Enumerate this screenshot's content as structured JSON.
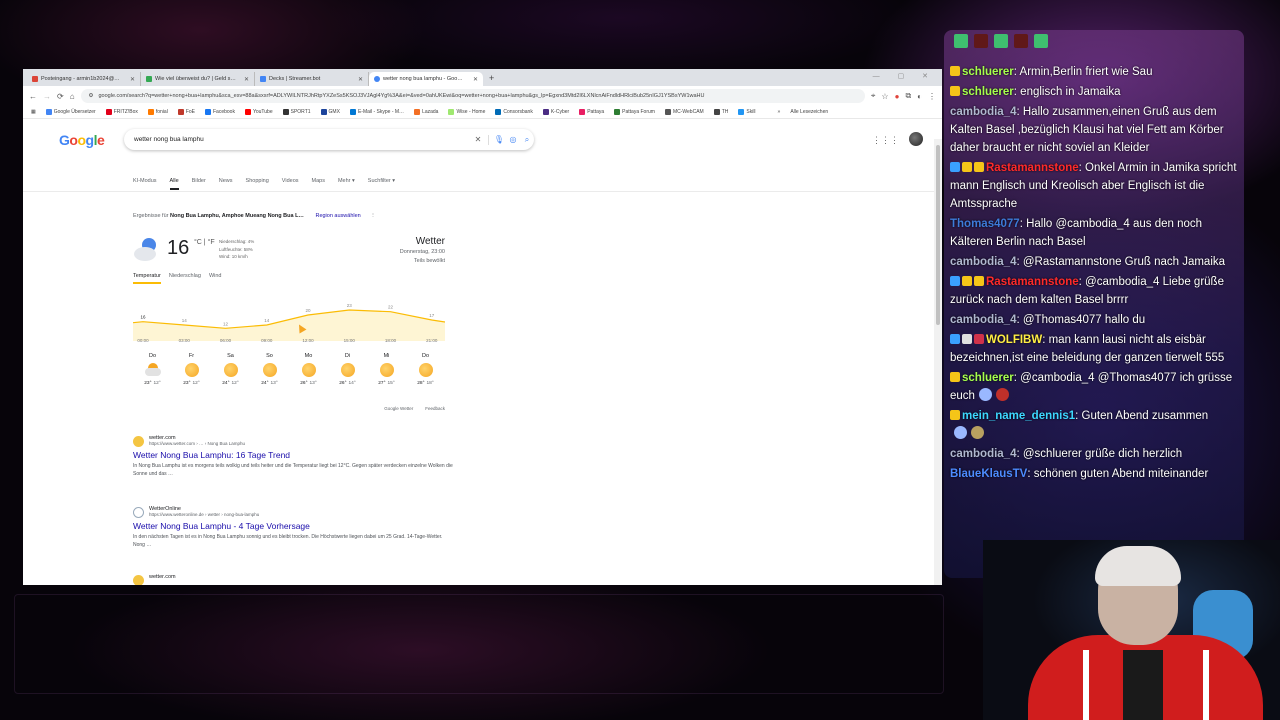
{
  "browser": {
    "tabs": [
      {
        "label": "Posteingang - armin1b2024@…",
        "color": "#db4437"
      },
      {
        "label": "Wie viel überweist du? | Geld s…",
        "color": "#34a853"
      },
      {
        "label": "Decks | Streamer.bot",
        "color": "#4285f4"
      },
      {
        "label": "wetter nong bua lamphu - Goo…",
        "color": "#4285f4"
      }
    ],
    "new_tab": "+",
    "url": "google.com/search?q=wetter+nong+bua+lamphu&sca_esv=88a&sxsrf=ADLYWILNTRJhRtpYXZeSs5KSOJ3VJAgl4Yg%3A&ei=&ved=0ahUKEwi&oq=wetter+nong+bua+lamphu&gs_lp=Egxnd3Mtd2l6LXNlcnAiFndldHRlciBub25nIGJ1YSBsYW1waHU",
    "bookmarks": [
      {
        "label": "Google Übersetzer",
        "color": "#4285f4"
      },
      {
        "label": "FRITZ!Box",
        "color": "#e2001a"
      },
      {
        "label": "fonial",
        "color": "#ff7a00"
      },
      {
        "label": "FoE",
        "color": "#c0392b"
      },
      {
        "label": "Facebook",
        "color": "#1877f2"
      },
      {
        "label": "YouTube",
        "color": "#ff0000"
      },
      {
        "label": "SPORT1",
        "color": "#333333"
      },
      {
        "label": "GMX",
        "color": "#1c449b"
      },
      {
        "label": "E-Mail - Skype - M…",
        "color": "#0078d4"
      },
      {
        "label": "Lazada",
        "color": "#f36f24"
      },
      {
        "label": "Wise - Home",
        "color": "#9fe870"
      },
      {
        "label": "Consorsbank",
        "color": "#006bb6"
      },
      {
        "label": "K-Cyber",
        "color": "#4a2c83"
      },
      {
        "label": "Pattaya",
        "color": "#e91e63"
      },
      {
        "label": "Pattaya Forum",
        "color": "#2e7d32"
      },
      {
        "label": "MC-WebCAM",
        "color": "#555555"
      },
      {
        "label": "TH",
        "color": "#444444"
      },
      {
        "label": "Skill",
        "color": "#2196f3"
      }
    ],
    "all_bookmarks": "Alle Lesezeichen"
  },
  "google": {
    "logo": [
      "G",
      "o",
      "o",
      "g",
      "l",
      "e"
    ],
    "query": "wetter nong bua lamphu",
    "nav": [
      "KI-Modus",
      "Alle",
      "Bilder",
      "News",
      "Shopping",
      "Videos",
      "Maps",
      "Mehr ▾",
      "Suchfilter ▾"
    ],
    "results_for_prefix": "Ergebnisse für",
    "results_for_place": "Nong Bua Lamphu, Amphoe Mueang Nong Bua L…",
    "region_link": "Region auswählen"
  },
  "weather": {
    "temp": "16",
    "unit": "°C | °F",
    "precip": "Niederschlag: 4%",
    "humidity": "Luftfeuchte: 58%",
    "wind": "Wind: 10 km/h",
    "title": "Wetter",
    "when": "Donnerstag, 23:00",
    "condition": "Teils bewölkt",
    "tabs": [
      "Temperatur",
      "Niederschlag",
      "Wind"
    ],
    "hours": [
      "00:00",
      "03:00",
      "06:00",
      "09:00",
      "12:00",
      "15:00",
      "18:00",
      "21:00"
    ],
    "hour_temps": [
      16,
      14,
      12,
      14,
      20,
      23,
      22,
      17
    ],
    "days": [
      {
        "day": "Do",
        "hi": "23°",
        "lo": "12°",
        "icon": "partly-cloudy"
      },
      {
        "day": "Fr",
        "hi": "23°",
        "lo": "12°",
        "icon": "sunny"
      },
      {
        "day": "Sa",
        "hi": "24°",
        "lo": "12°",
        "icon": "sunny"
      },
      {
        "day": "So",
        "hi": "24°",
        "lo": "13°",
        "icon": "sunny"
      },
      {
        "day": "Mo",
        "hi": "26°",
        "lo": "13°",
        "icon": "sunny"
      },
      {
        "day": "Di",
        "hi": "26°",
        "lo": "14°",
        "icon": "sunny"
      },
      {
        "day": "Mi",
        "hi": "27°",
        "lo": "15°",
        "icon": "sunny"
      },
      {
        "day": "Do",
        "hi": "28°",
        "lo": "18°",
        "icon": "sunny"
      }
    ],
    "source": "Google Wetter",
    "feedback": "Feedback",
    "accent": "#fbbc05"
  },
  "results": [
    {
      "name": "wetter.com",
      "url": "https://www.wetter.com › … › Nong Bua Lamphu",
      "title": "Wetter Nong Bua Lamphu: 16 Tage Trend",
      "snippet": "In Nong Bua Lamphu ist es morgens teils wolkig und teils heiter und die Temperatur liegt bei 12°C. Gegen später verdecken einzelne Wolken die Sonne und das …"
    },
    {
      "name": "WetterOnline",
      "url": "https://www.wetteronline.de › wetter › nong-bua-lamphu",
      "title": "Wetter Nong Bua Lamphu - 4 Tage Vorhersage",
      "snippet": "In den nächsten Tagen ist es in Nong Bua Lamphu sonnig und es bleibt trocken. Die Höchstwerte liegen dabei um 25 Grad. 14-Tage-Wetter. Nong …"
    },
    {
      "name": "wetter.com",
      "url": "",
      "title": "",
      "snippet": ""
    }
  ],
  "chat": {
    "messages": [
      {
        "user": "schluerer",
        "color": "#a6ff4d",
        "badges": [
          "#f5c518"
        ],
        "text": ": Armin,Berlin friert wie Sau"
      },
      {
        "user": "schluerer",
        "color": "#a6ff4d",
        "badges": [
          "#f5c518"
        ],
        "text": ": englisch in Jamaika"
      },
      {
        "user": "cambodia_4",
        "color": "#b0b8d0",
        "badges": [],
        "text": ": Hallo zusammen,einen Gruß aus dem Kalten Basel ,bezüglich Klausi hat viel Fett am Körber daher braucht er nicht soviel an Kleider"
      },
      {
        "user": "Rastamannstone",
        "color": "#ff2a2a",
        "badges": [
          "#3aa0ff",
          "#f5c518",
          "#f5c518"
        ],
        "text": ": Onkel Armin in Jamika spricht mann Englisch und Kreolisch aber Englisch ist die Amtssprache"
      },
      {
        "user": "Thomas4077",
        "color": "#3d7bd9",
        "badges": [],
        "text": ": Hallo @cambodia_4 aus den noch Kälteren Berlin nach Basel"
      },
      {
        "user": "cambodia_4",
        "color": "#b0b8d0",
        "badges": [],
        "text": ": @Rastamannstone Gruß nach Jamaika"
      },
      {
        "user": "Rastamannstone",
        "color": "#ff2a2a",
        "badges": [
          "#3aa0ff",
          "#f5c518",
          "#f5c518"
        ],
        "text": ": @cambodia_4 Liebe grüße zurück nach dem kalten Basel brrrr"
      },
      {
        "user": "cambodia_4",
        "color": "#b0b8d0",
        "badges": [],
        "text": ": @Thomas4077 hallo du"
      },
      {
        "user": "WOLFIBW",
        "color": "#ffee44",
        "badges": [
          "#3aa0ff",
          "#e0e0e0",
          "#d0324a"
        ],
        "text": ": man kann lausi nicht als eisbär bezeichnen,ist eine beleidung der ganzen tierwelt 555"
      },
      {
        "user": "schluerer",
        "color": "#a6ff4d",
        "badges": [
          "#f5c518"
        ],
        "text": ": @cambodia_4 @Thomas4077 ich grüsse euch"
      },
      {
        "user": "mein_name_dennis1",
        "color": "#3dd7ff",
        "badges": [
          "#f5c518"
        ],
        "text": ": Guten Abend zusammen"
      },
      {
        "user": "cambodia_4",
        "color": "#b0b8d0",
        "badges": [],
        "text": ": @schluerer grüße dich herzlich"
      },
      {
        "user": "BlaueKlausTV",
        "color": "#4d8bff",
        "badges": [],
        "text": ": schönen guten Abend miteinander"
      }
    ]
  }
}
